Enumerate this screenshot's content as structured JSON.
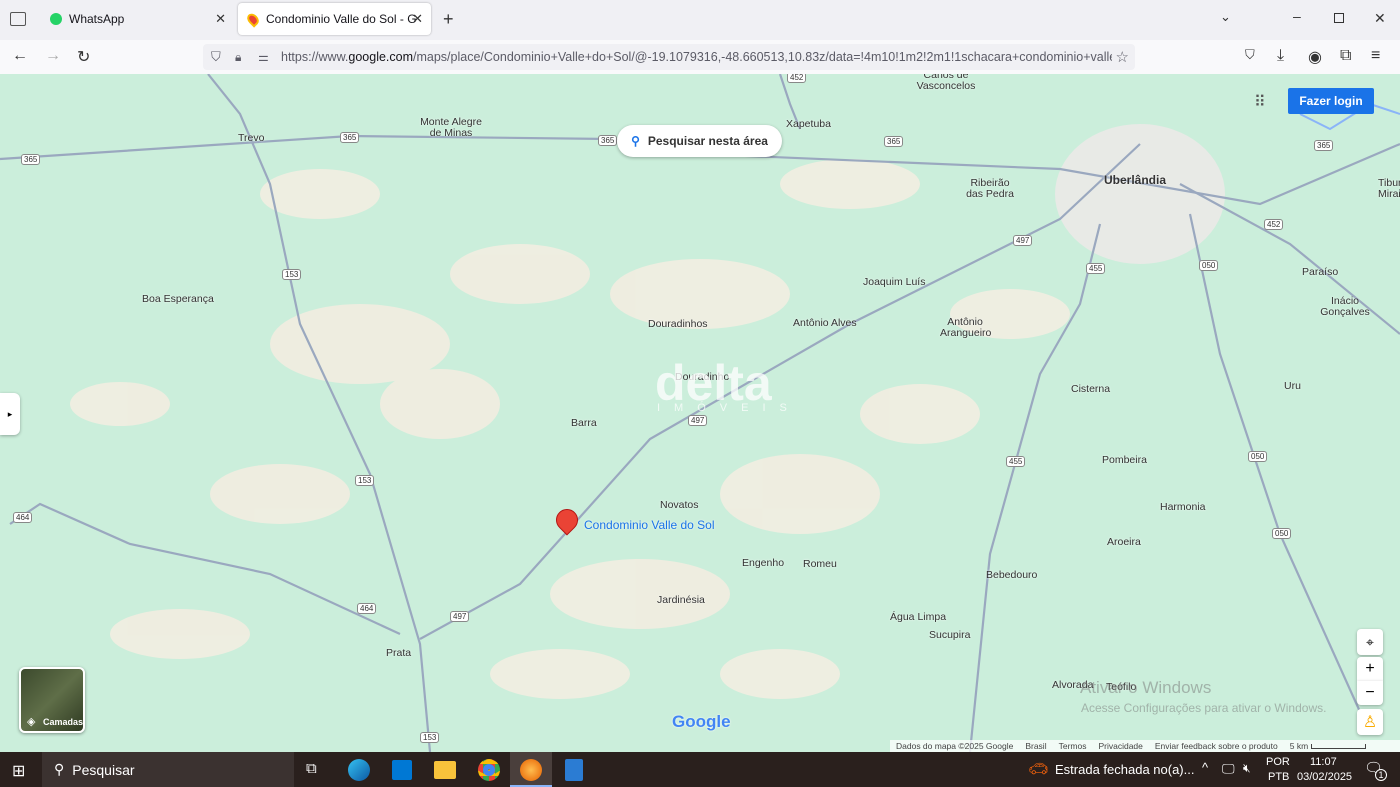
{
  "browser": {
    "tabs": [
      {
        "label": "WhatsApp",
        "icon": "whatsapp-icon"
      },
      {
        "label": "Condominio Valle do Sol - Goog",
        "icon": "google-maps-icon"
      }
    ],
    "url_prefix": "https://www.",
    "url_domain": "google.com",
    "url_rest": "/maps/place/Condominio+Valle+do+Sol/@-19.1079316,-48.660513,10.83z/data=!4m10!1m2!2m1!1schacara+condominio+valle"
  },
  "map": {
    "search_area_label": "Pesquisar nesta área",
    "login_label": "Fazer login",
    "layers_label": "Camadas",
    "pin_label": "Condominio Valle do Sol",
    "google_logo": "Google",
    "watermark": "delta",
    "watermark_sub": "IMÓVEIS",
    "places": [
      "Monte Alegre de Minas",
      "Trevo",
      "Xapetuba",
      "Canos de Vasconcelos",
      "Ribeirão das Pedra",
      "Uberlândia",
      "Tiburi Mirai",
      "Boa Esperança",
      "Douradinhos",
      "Antônio Alves",
      "Joaquim Luís",
      "Antônio Arangueiro",
      "Paraíso",
      "Inácio Gonçalves",
      "Douradinho",
      "Barra",
      "Cisterna",
      "Uru",
      "Pombeira",
      "Novatos",
      "Harmonia",
      "Aroeira",
      "Engenho",
      "Romeu",
      "Bebedouro",
      "Jardinésia",
      "Água Limpa",
      "Sucupira",
      "Prata",
      "Alvorada",
      "Teófilo"
    ],
    "roads": [
      "365",
      "365",
      "365",
      "365",
      "365",
      "452",
      "452",
      "153",
      "153",
      "153",
      "497",
      "497",
      "497",
      "455",
      "455",
      "050",
      "050",
      "050",
      "464",
      "464"
    ],
    "footer": {
      "data": "Dados do mapa ©2025 Google",
      "country": "Brasil",
      "terms": "Termos",
      "privacy": "Privacidade",
      "feedback": "Enviar feedback sobre o produto",
      "scale": "5 km"
    },
    "activation_title": "Ativar o Windows",
    "activation_sub": "Acesse Configurações para ativar o Windows."
  },
  "taskbar": {
    "search": "Pesquisar",
    "notification": "Estrada fechada no(a)...",
    "lang1": "POR",
    "lang2": "PTB",
    "time": "11:07",
    "date": "03/02/2025",
    "badge": "1"
  },
  "colors": {
    "accent": "#1a73e8",
    "pin": "#ea4335",
    "map_green": "#cbeedb",
    "taskbar": "#2a201d"
  }
}
